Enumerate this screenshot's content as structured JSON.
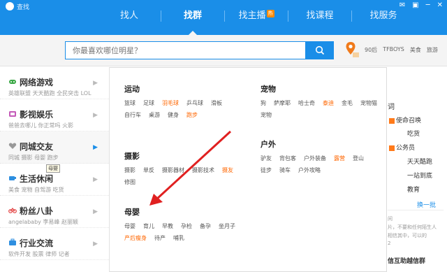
{
  "window": {
    "title": "查找",
    "controls": [
      "✉",
      "▣",
      "─",
      "✕"
    ]
  },
  "tabs": [
    {
      "label": "找人",
      "active": false,
      "hot": false
    },
    {
      "label": "找群",
      "active": true,
      "hot": false
    },
    {
      "label": "找主播",
      "active": false,
      "hot": true,
      "hot_badge": "热"
    },
    {
      "label": "找课程",
      "active": false,
      "hot": false
    },
    {
      "label": "找服务",
      "active": false,
      "hot": false
    }
  ],
  "search": {
    "placeholder": "你最喜欢哪位明星？",
    "button_icon": "search-icon",
    "hot_tags": [
      "90后",
      "TFBOYS",
      "美食",
      "旅游"
    ]
  },
  "sidebar": [
    {
      "name": "网络游戏",
      "sub": "英雄联盟  天天酷跑  全民突击  LOL",
      "icon": "gamepad-icon",
      "color": "#3aa845"
    },
    {
      "name": "影视娱乐",
      "sub": "爸爸去哪儿  你正常吗  火影",
      "icon": "film-icon",
      "color": "#c45ab8"
    },
    {
      "name": "同城交友",
      "sub": "同城  摄影  母婴  跑步",
      "icon": "heart-icon",
      "color": "#999999",
      "active": true
    },
    {
      "name": "生活休闲",
      "sub": "美食  宠物  自驾游  吃货",
      "icon": "cup-icon",
      "color": "#2e8fe0"
    },
    {
      "name": "粉丝八卦",
      "sub": "angelababy  李易峰  赵丽颖",
      "icon": "bike-icon",
      "color": "#e23c3c"
    },
    {
      "name": "行业交流",
      "sub": "软件开发  股票  律师  记者",
      "icon": "briefcase-icon",
      "color": "#2e8fe0"
    }
  ],
  "tooltip": "母婴",
  "panel": {
    "groups": [
      {
        "title": "运动",
        "items": [
          {
            "t": "篮球"
          },
          {
            "t": "足球"
          },
          {
            "t": "羽毛球",
            "o": true
          },
          {
            "t": "乒乓球"
          },
          {
            "t": "滑板"
          },
          {
            "t": "自行车"
          },
          {
            "t": "桌游"
          },
          {
            "t": "健身"
          },
          {
            "t": "跑步",
            "o": true
          }
        ]
      },
      {
        "title": "宠物",
        "items": [
          {
            "t": "狗"
          },
          {
            "t": "萨摩耶"
          },
          {
            "t": "哈士奇"
          },
          {
            "t": "泰迪",
            "o": true
          },
          {
            "t": "金毛"
          },
          {
            "t": "宠物猫"
          },
          {
            "t": "宠物"
          }
        ]
      },
      {
        "title": "户外",
        "items": [
          {
            "t": "驴友"
          },
          {
            "t": "背包客"
          },
          {
            "t": "户外装备"
          },
          {
            "t": "露营",
            "o": true
          },
          {
            "t": "登山"
          },
          {
            "t": "徒步"
          },
          {
            "t": "骑车"
          },
          {
            "t": "户外攻略"
          }
        ]
      },
      {
        "title": "摄影",
        "items": [
          {
            "t": "摄影"
          },
          {
            "t": "单反"
          },
          {
            "t": "摄影器材"
          },
          {
            "t": "摄影技术"
          },
          {
            "t": "摄友",
            "o": true
          },
          {
            "t": "修图"
          }
        ]
      },
      {
        "title": "母婴",
        "items": [
          {
            "t": "母婴"
          },
          {
            "t": "育儿"
          },
          {
            "t": "早教"
          },
          {
            "t": "孕检"
          },
          {
            "t": "备孕"
          },
          {
            "t": "坐月子"
          },
          {
            "t": "产后瘦身",
            "o": true
          },
          {
            "t": "待产"
          },
          {
            "t": "哺乳"
          }
        ]
      }
    ]
  },
  "rightcol": {
    "title": "词",
    "items": [
      {
        "text": "使命召唤",
        "badge": true
      },
      {
        "text": "吃货",
        "badge": false
      },
      {
        "text": "公务员",
        "badge": true
      },
      {
        "text": "天天酷跑",
        "badge": false
      },
      {
        "text": "一站到底",
        "badge": false
      },
      {
        "text": "教育",
        "badge": false
      }
    ],
    "switch": "换一批",
    "small": [
      "间",
      "片，不要和任何陌生人",
      "相信其中，可以的",
      "2"
    ],
    "bottom": "信互助越信群"
  },
  "colors": {
    "accent": "#1a8ee8",
    "orange": "#ff6600",
    "arrow": "#e02020"
  }
}
